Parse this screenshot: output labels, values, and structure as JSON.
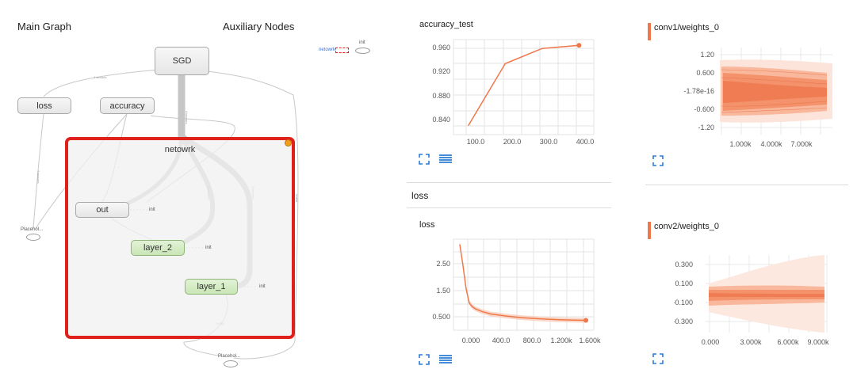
{
  "graph": {
    "main_title": "Main Graph",
    "aux_title": "Auxiliary Nodes",
    "nodes": {
      "sgd": "SGD",
      "loss": "loss",
      "accuracy": "accuracy",
      "network": "netowrk",
      "out": "out",
      "layer2": "layer_2",
      "layer1": "layer_1",
      "placeholder_left": "Placehol...",
      "placeholder_bottom": "Placehol...",
      "init": "init",
      "aux_network": "netowrk",
      "aux_init": "init"
    }
  },
  "panels": {
    "accuracy_test": {
      "title": "accuracy_test",
      "y_ticks": [
        "0.960",
        "0.920",
        "0.880",
        "0.840"
      ],
      "x_ticks": [
        "100.0",
        "200.0",
        "300.0",
        "400.0"
      ]
    },
    "loss_section": {
      "title": "loss"
    },
    "loss": {
      "title": "loss",
      "y_ticks": [
        "2.50",
        "1.50",
        "0.500"
      ],
      "x_ticks": [
        "0.000",
        "400.0",
        "800.0",
        "1.200k",
        "1.600k"
      ]
    },
    "conv1": {
      "title": "conv1/weights_0",
      "y_ticks": [
        "1.20",
        "0.600",
        "-1.78e-16",
        "-0.600",
        "-1.20"
      ],
      "x_ticks": [
        "1.000k",
        "4.000k",
        "7.000k"
      ]
    },
    "conv2": {
      "title": "conv2/weights_0",
      "y_ticks": [
        "0.300",
        "0.100",
        "-0.100",
        "-0.300"
      ],
      "x_ticks": [
        "0.000",
        "3.000k",
        "6.000k",
        "9.000k"
      ]
    }
  },
  "chart_data": [
    {
      "type": "line",
      "title": "accuracy_test",
      "x": [
        100,
        200,
        300,
        400
      ],
      "series": [
        {
          "values": [
            0.839,
            0.937,
            0.961,
            0.966
          ]
        }
      ],
      "xlim": [
        60,
        440
      ],
      "ylim": [
        0.825,
        0.975
      ],
      "grid": true
    },
    {
      "type": "line",
      "title": "loss",
      "x": [
        0,
        40,
        80,
        120,
        160,
        200,
        280,
        400,
        600,
        800,
        1000,
        1200,
        1400,
        1600
      ],
      "series": [
        {
          "values": [
            3.2,
            2.4,
            1.5,
            0.95,
            0.8,
            0.72,
            0.62,
            0.52,
            0.44,
            0.38,
            0.34,
            0.31,
            0.29,
            0.28
          ]
        }
      ],
      "xlim": [
        -80,
        1700
      ],
      "ylim": [
        -0.1,
        3.4
      ],
      "grid": true
    }
  ],
  "colors": {
    "accent": "#f0774a",
    "highlight_border": "#e0201b",
    "node_green": "#c9e6b6",
    "icon_blue": "#2a7dd6"
  }
}
